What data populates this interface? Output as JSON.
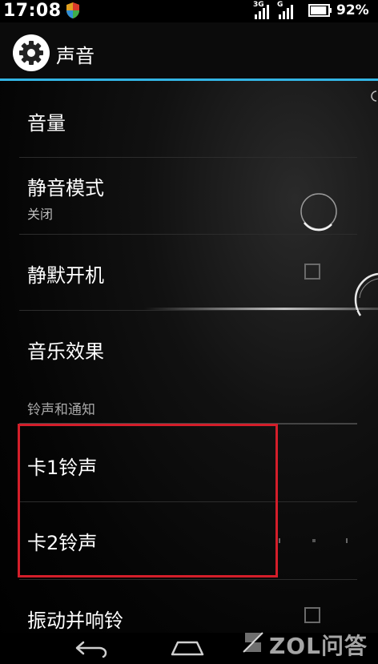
{
  "status_bar": {
    "time": "17:08",
    "network_1": "3G",
    "network_2": "G",
    "battery_percent": "92%",
    "battery_level": 0.92
  },
  "action_bar": {
    "title": "声音",
    "icon": "gear-icon"
  },
  "settings": {
    "volume": {
      "title": "音量"
    },
    "silent_mode": {
      "title": "静音模式",
      "summary": "关闭"
    },
    "silent_boot": {
      "title": "静默开机",
      "checked": false
    },
    "music_effects": {
      "title": "音乐效果"
    },
    "ringtone_section": {
      "header": "铃声和通知"
    },
    "sim1_ringtone": {
      "title": "卡1铃声"
    },
    "sim2_ringtone": {
      "title": "卡2铃声"
    },
    "vibrate_and_ring": {
      "title": "振动并响铃",
      "checked": false
    }
  },
  "annotation": {
    "highlight_color": "#d41e2a"
  },
  "accent_color": "#33b5e5",
  "navigation": {
    "back": "back-icon",
    "home": "home-icon"
  },
  "watermark": {
    "text": "ZOL问答"
  }
}
